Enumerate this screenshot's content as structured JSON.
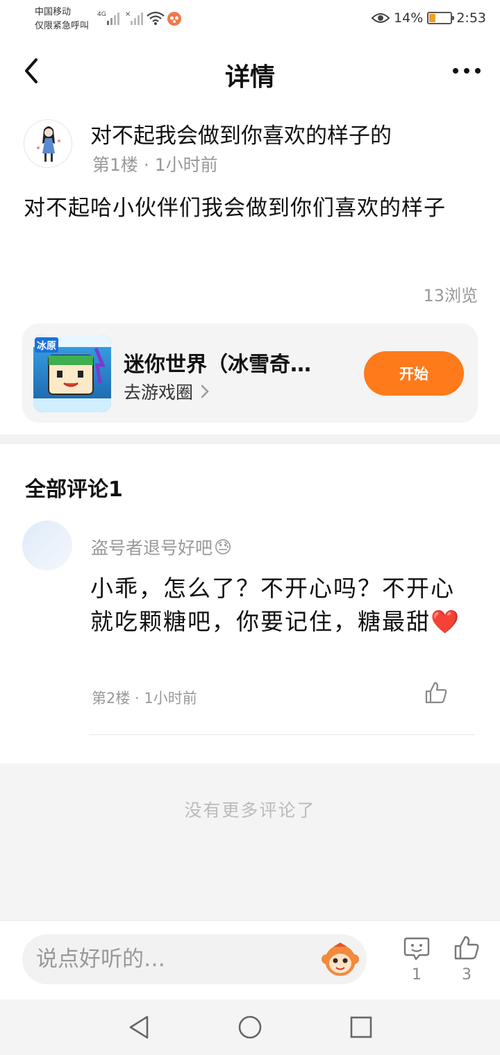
{
  "status_bar": {
    "carrier_line1": "中国移动",
    "carrier_line2": "仅限紧急呼叫",
    "network": "4G",
    "battery_text": "14%",
    "battery_level": 0.14,
    "time": "2:53"
  },
  "header": {
    "title": "详情"
  },
  "post": {
    "author": "对不起我会做到你喜欢的样子的",
    "meta": "第1楼 · 1小时前",
    "body": "对不起哈小伙伴们我会做到你们喜欢的样子",
    "views": "13浏览"
  },
  "game_card": {
    "name": "迷你世界（冰雪奇…",
    "link_label": "去游戏圈",
    "icon_badge": "冰原",
    "start_label": "开始",
    "accent": "#ff7a1a"
  },
  "comments": {
    "section_title": "全部评论1",
    "items": [
      {
        "author": "盗号者退号好吧",
        "author_emoji": "😓",
        "body": "小乖，怎么了？不开心吗？不开心就吃颗糖吧，你要记住，糖最甜❤️",
        "meta": "第2楼 · 1小时前"
      }
    ],
    "no_more": "没有更多评论了"
  },
  "bottom_bar": {
    "input_placeholder": "说点好听的…",
    "comment_count": "1",
    "like_count": "3"
  }
}
